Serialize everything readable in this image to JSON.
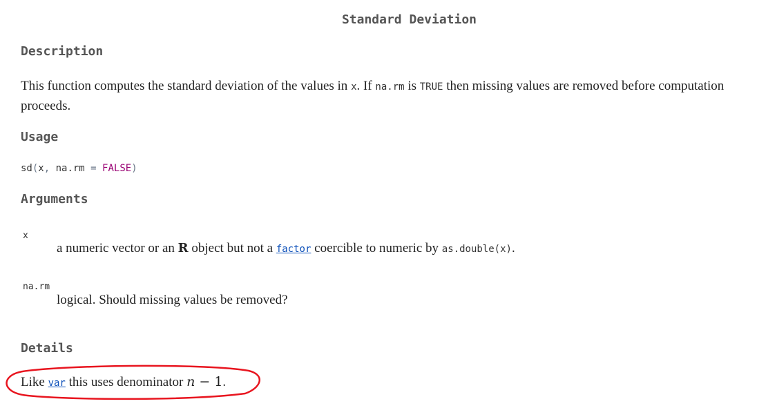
{
  "title": "Standard Deviation",
  "description": {
    "heading": "Description",
    "text_1": "This function computes the standard deviation of the values in ",
    "code_x": "x",
    "text_2": ". If ",
    "code_narm": "na.rm",
    "text_3": " is ",
    "code_true": "TRUE",
    "text_4": " then missing values are removed before computation proceeds."
  },
  "usage": {
    "heading": "Usage",
    "fn": "sd",
    "open": "(",
    "arg1": "x",
    "comma": ", ",
    "arg2": "na.rm",
    "eq": " = ",
    "default": "FALSE",
    "close": ")"
  },
  "arguments": {
    "heading": "Arguments",
    "items": [
      {
        "name": "x",
        "desc_1": "a numeric vector or an ",
        "r_logo": "R",
        "desc_2": " object but not a ",
        "link": "factor",
        "desc_3": " coercible to numeric by ",
        "code": "as.double(x)",
        "desc_4": "."
      },
      {
        "name": "na.rm",
        "desc": "logical. Should missing values be removed?"
      }
    ]
  },
  "details": {
    "heading": "Details",
    "text_1": "Like ",
    "link": "var",
    "text_2": " this uses denominator ",
    "math_n": "n",
    "math_rest": " − 1",
    "text_3": "."
  },
  "colors": {
    "link": "#0b4fb9",
    "heading": "#555555",
    "annotation": "#e8151f",
    "keyword": "#990073"
  }
}
